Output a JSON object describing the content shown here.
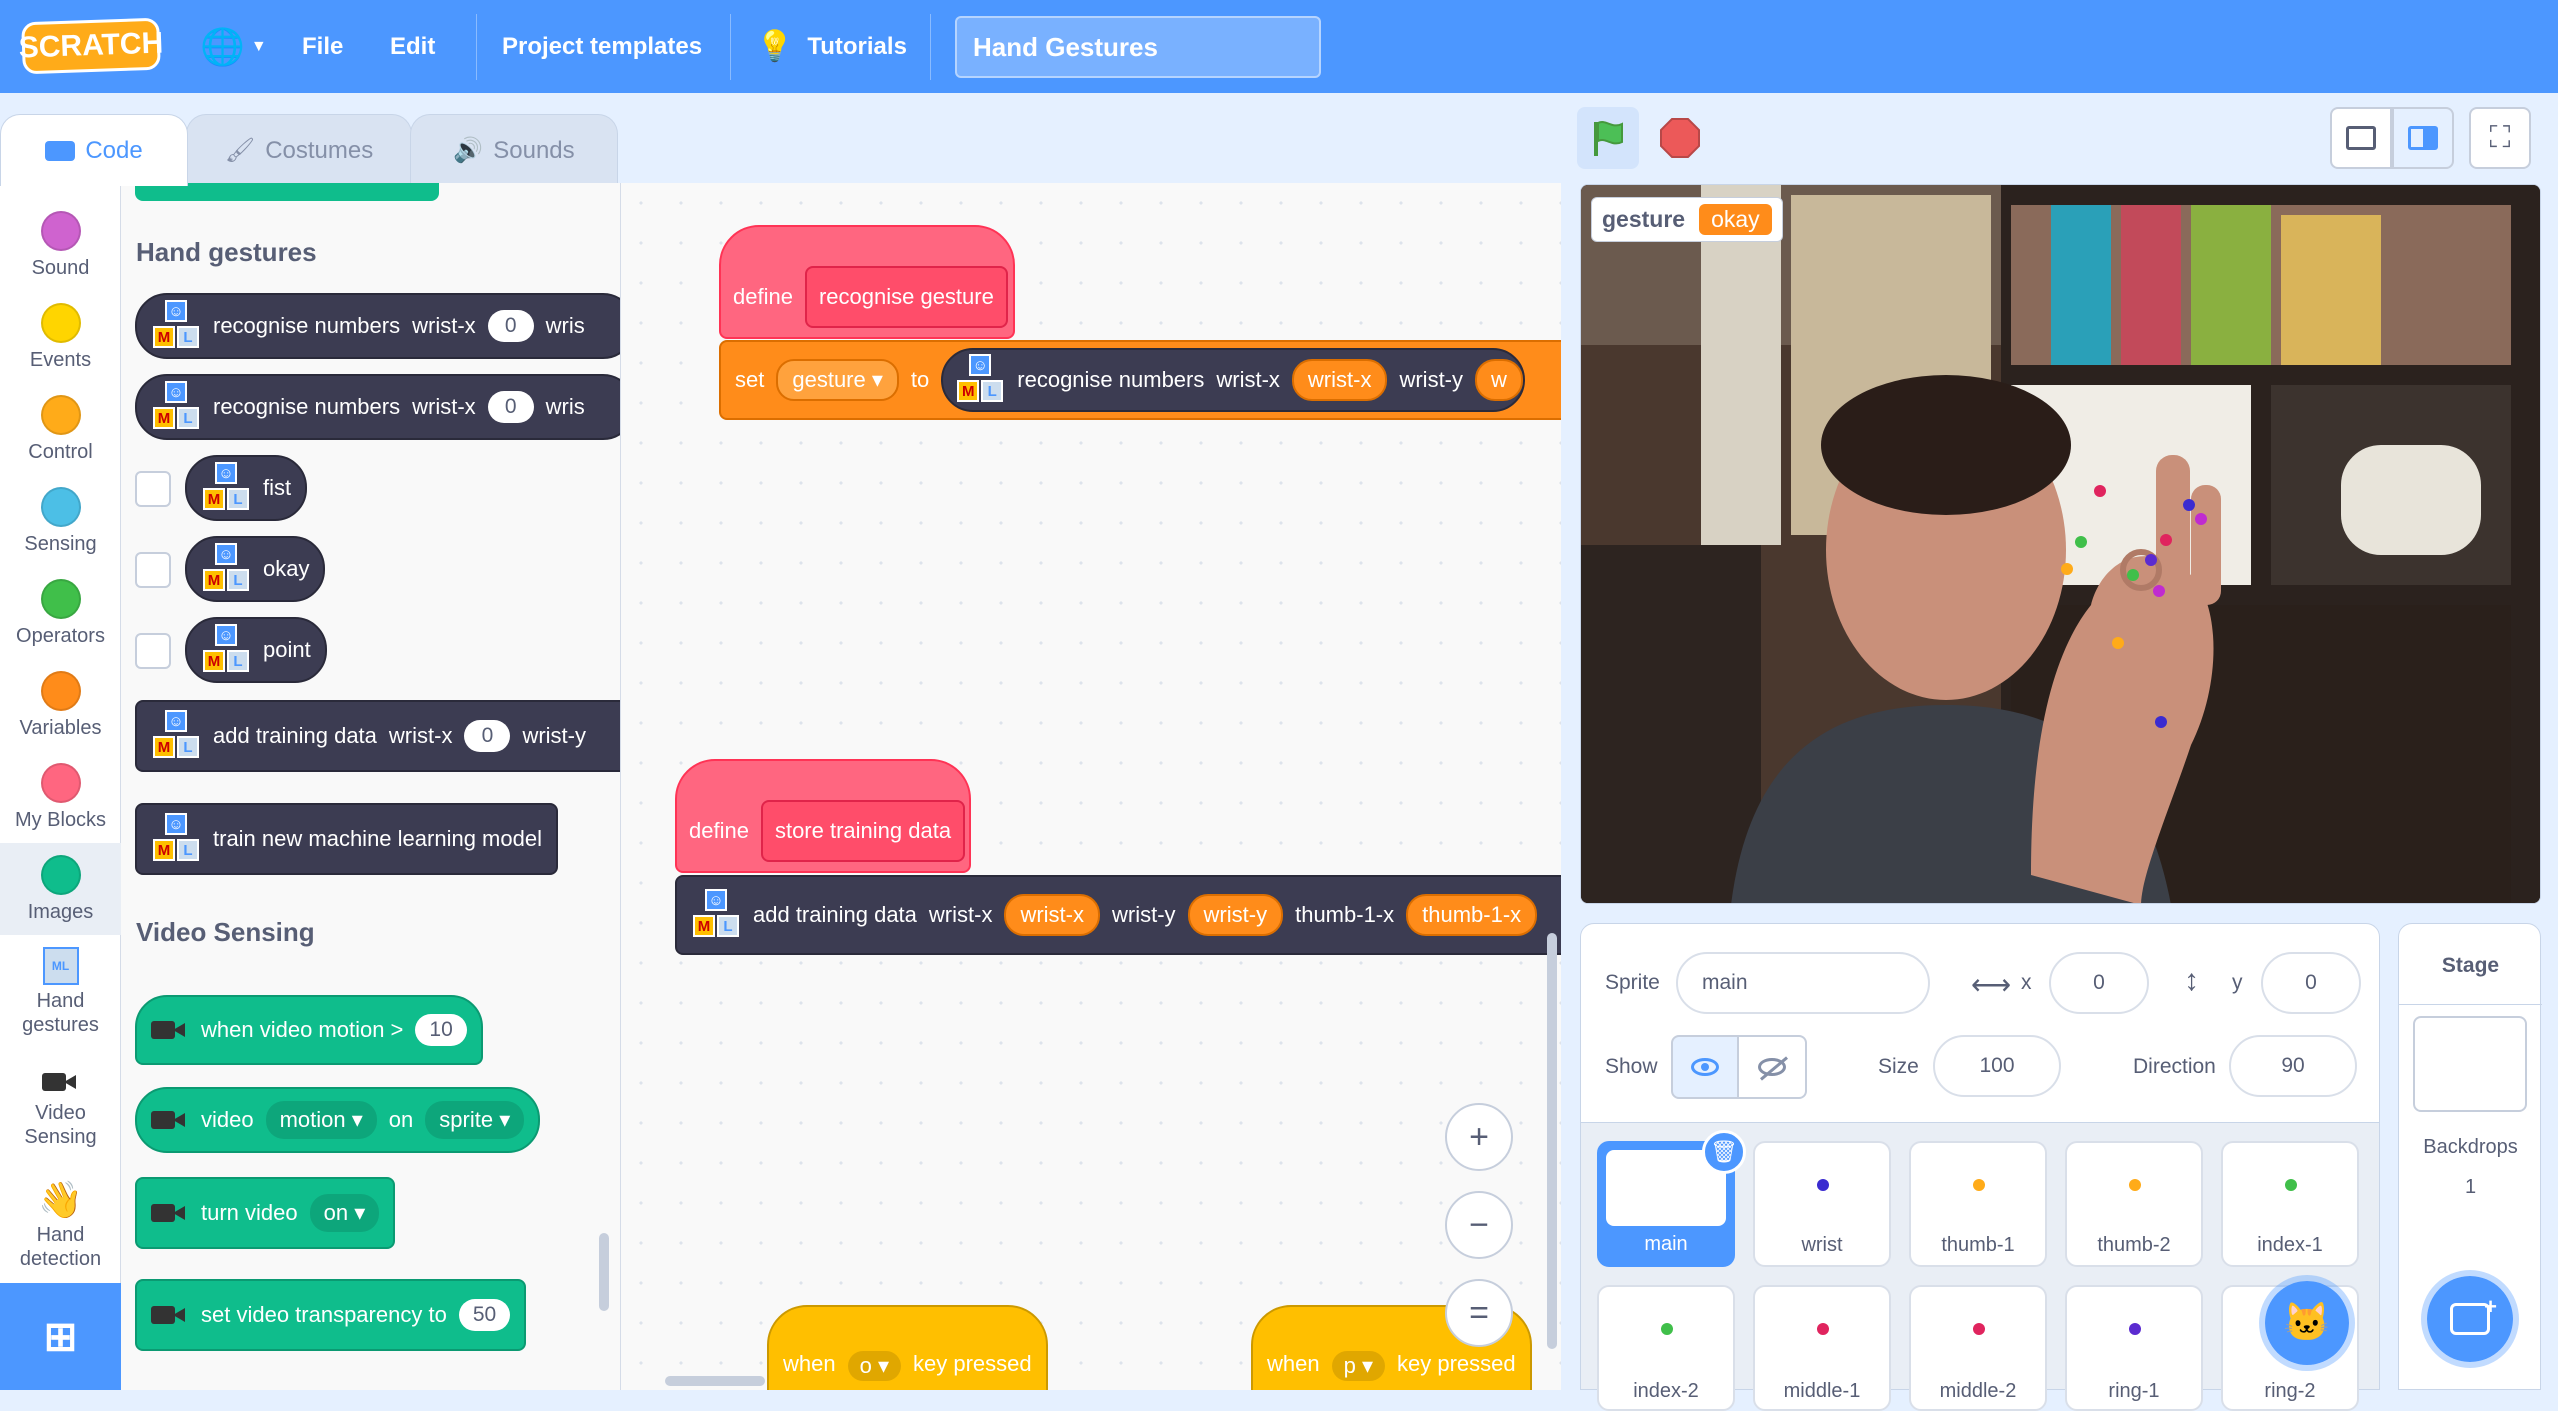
{
  "menubar": {
    "logo": "SCRATCH",
    "file": "File",
    "edit": "Edit",
    "templates": "Project templates",
    "tutorials": "Tutorials",
    "project_title": "Hand Gestures"
  },
  "tabs": [
    "Code",
    "Costumes",
    "Sounds"
  ],
  "categories": [
    {
      "label": "Sound",
      "color": "#cf63cf"
    },
    {
      "label": "Events",
      "color": "#ffd500"
    },
    {
      "label": "Control",
      "color": "#ffab19"
    },
    {
      "label": "Sensing",
      "color": "#4cbfe6"
    },
    {
      "label": "Operators",
      "color": "#40bf4a"
    },
    {
      "label": "Variables",
      "color": "#ff8c1a"
    },
    {
      "label": "My Blocks",
      "color": "#ff6680"
    },
    {
      "label": "Images",
      "color": "#0fbd8c"
    },
    {
      "label": "Hand gestures"
    },
    {
      "label": "Video Sensing"
    },
    {
      "label": "Hand detection"
    }
  ],
  "palette": {
    "hand_gestures_header": "Hand gestures",
    "recognise_numbers": "recognise numbers",
    "wrist_x": "wrist-x",
    "wrist_y": "wrist-y",
    "wris": "wris",
    "zero": "0",
    "fist": "fist",
    "okay": "okay",
    "point": "point",
    "add_training_data": "add training data",
    "train_model": "train new machine learning model",
    "video_sensing_header": "Video Sensing",
    "when_video_motion": "when video motion >",
    "motion_value": "10",
    "video": "video",
    "motion": "motion",
    "on": "on",
    "sprite": "sprite",
    "turn_video": "turn video",
    "turn_on": "on",
    "set_transparency": "set video transparency to",
    "transparency_value": "50"
  },
  "workspace": {
    "define": "define",
    "recognise_gesture": "recognise gesture",
    "set": "set",
    "gesture_var": "gesture",
    "to": "to",
    "recognise_numbers": "recognise numbers",
    "wrist_x": "wrist-x",
    "wrist_y": "wrist-y",
    "w": "w",
    "store_training_data": "store training data",
    "add_training_data": "add training data",
    "thumb_1_x": "thumb-1-x",
    "thumb_1_x_short": "thumb-1-x",
    "when": "when",
    "key_o": "o",
    "key_p": "p",
    "key_pressed": "key pressed",
    "zoom_in": "+",
    "zoom_out": "−",
    "zoom_reset": "="
  },
  "stage": {
    "monitor_label": "gesture",
    "monitor_value": "okay"
  },
  "sprite_info": {
    "sprite_label": "Sprite",
    "sprite_name": "main",
    "x_label": "x",
    "x_value": "0",
    "y_label": "y",
    "y_value": "0",
    "show_label": "Show",
    "size_label": "Size",
    "size_value": "100",
    "direction_label": "Direction",
    "direction_value": "90"
  },
  "sprites": [
    {
      "name": "main",
      "color": ""
    },
    {
      "name": "wrist",
      "color": "#3a2bd0"
    },
    {
      "name": "thumb-1",
      "color": "#ffab19"
    },
    {
      "name": "thumb-2",
      "color": "#ffab19"
    },
    {
      "name": "index-1",
      "color": "#40bf4a"
    },
    {
      "name": "index-2",
      "color": "#40bf4a"
    },
    {
      "name": "middle-1",
      "color": "#e0245e"
    },
    {
      "name": "middle-2",
      "color": "#e0245e"
    },
    {
      "name": "ring-1",
      "color": "#5b2bd0"
    },
    {
      "name": "ring-2",
      "color": "#5b2bd0"
    }
  ],
  "stage_pane": {
    "title": "Stage",
    "backdrops_label": "Backdrops",
    "backdrops_count": "1"
  }
}
